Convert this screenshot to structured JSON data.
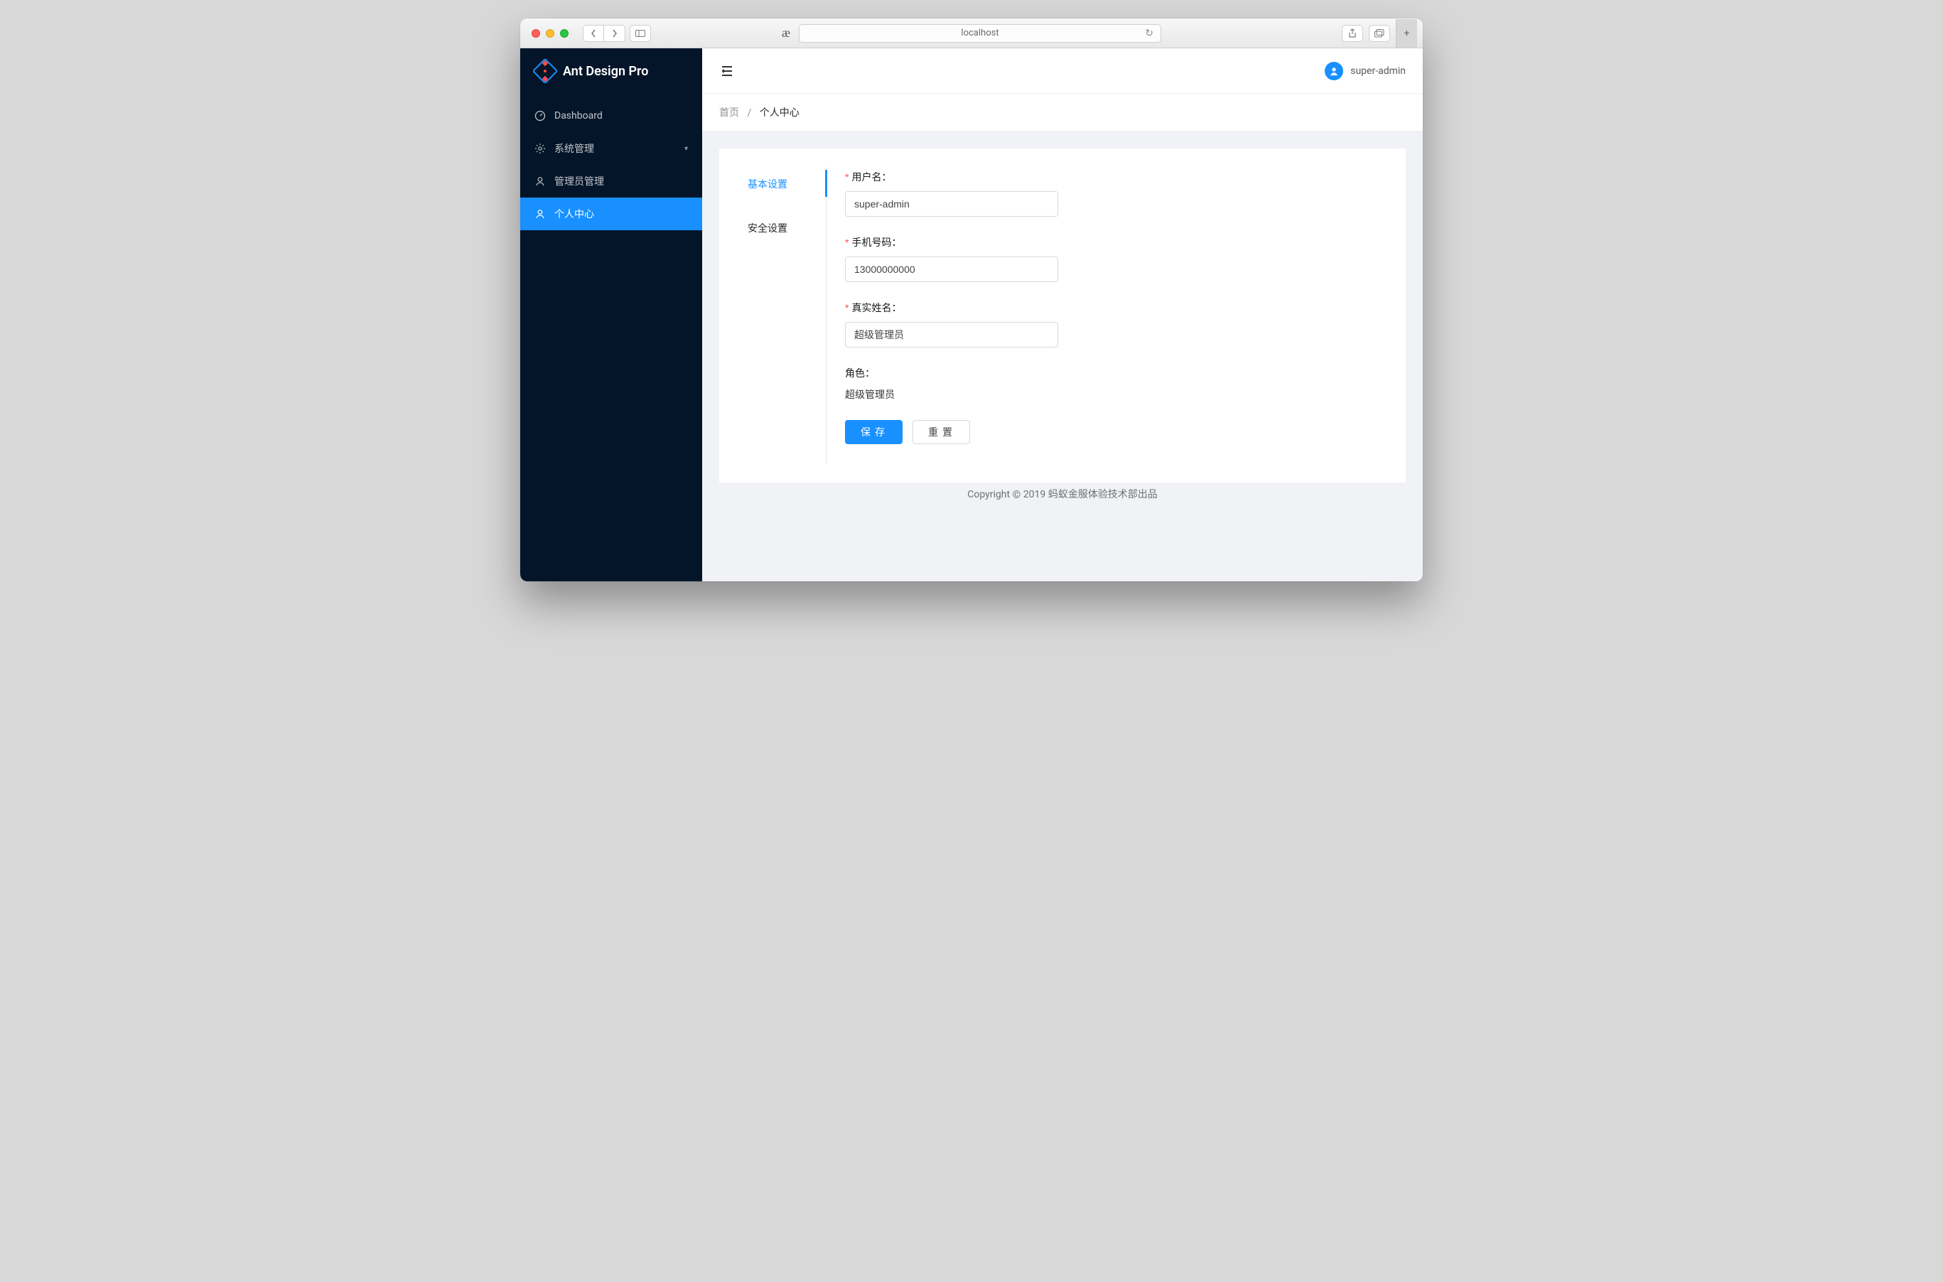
{
  "browser": {
    "url": "localhost",
    "reader_glyph": "æ"
  },
  "app": {
    "name": "Ant Design Pro"
  },
  "sidebar": {
    "items": [
      {
        "icon": "dashboard-icon",
        "label": "Dashboard",
        "expandable": false
      },
      {
        "icon": "settings-icon",
        "label": "系统管理",
        "expandable": true
      },
      {
        "icon": "user-icon",
        "label": "管理员管理",
        "expandable": false
      },
      {
        "icon": "user-icon",
        "label": "个人中心",
        "expandable": false,
        "active": true
      }
    ]
  },
  "header": {
    "username": "super-admin"
  },
  "breadcrumb": {
    "home": "首页",
    "sep": "/",
    "current": "个人中心"
  },
  "tabs": {
    "basic": "基本设置",
    "security": "安全设置"
  },
  "form": {
    "username_label": "用户名：",
    "username_value": "super-admin",
    "phone_label": "手机号码：",
    "phone_value": "13000000000",
    "realname_label": "真实姓名：",
    "realname_value": "超级管理员",
    "role_label": "角色：",
    "role_value": "超级管理员",
    "save_label": "保存",
    "reset_label": "重置"
  },
  "footer": {
    "text_left": "Copyright ",
    "text_right": " 2019 蚂蚁金服体验技术部出品"
  }
}
